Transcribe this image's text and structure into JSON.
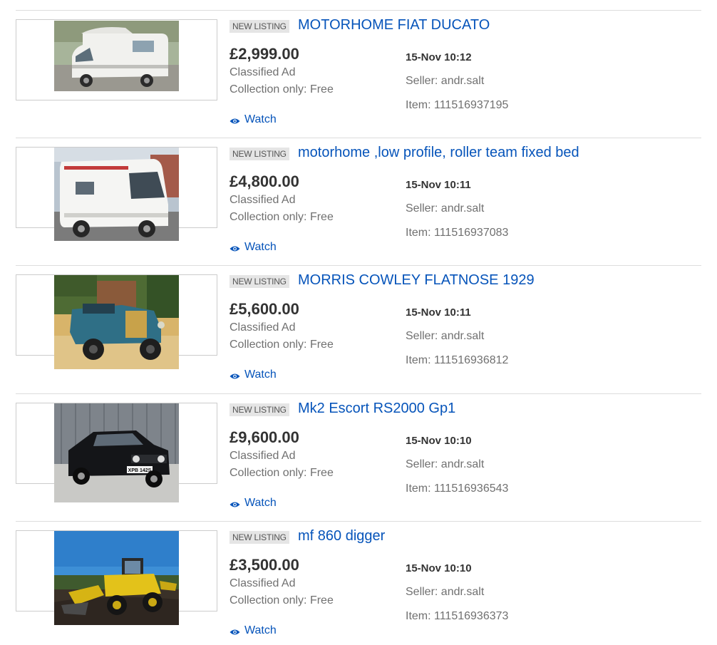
{
  "listings": [
    {
      "tag": "NEW LISTING",
      "title": "MOTORHOME FIAT DUCATO",
      "price": "£2,999.00",
      "format": "Classified Ad",
      "postage": "Collection only: Free",
      "watch": "Watch",
      "time": "15-Nov 10:12",
      "seller": "Seller: andr.salt",
      "item": "Item: 111516937195",
      "image": "white-motorhome-photo"
    },
    {
      "tag": "NEW LISTING",
      "title": "motorhome ,low profile, roller team fixed bed",
      "price": "£4,800.00",
      "format": "Classified Ad",
      "postage": "Collection only: Free",
      "watch": "Watch",
      "time": "15-Nov 10:11",
      "seller": "Seller: andr.salt",
      "item": "Item: 111516937083",
      "image": "white-low-profile-motorhome-photo"
    },
    {
      "tag": "NEW LISTING",
      "title": "MORRIS COWLEY FLATNOSE 1929",
      "price": "£5,600.00",
      "format": "Classified Ad",
      "postage": "Collection only: Free",
      "watch": "Watch",
      "time": "15-Nov 10:11",
      "seller": "Seller: andr.salt",
      "item": "Item: 111516936812",
      "image": "vintage-blue-car-photo"
    },
    {
      "tag": "NEW LISTING",
      "title": "Mk2 Escort RS2000 Gp1",
      "price": "£9,600.00",
      "format": "Classified Ad",
      "postage": "Collection only: Free",
      "watch": "Watch",
      "time": "15-Nov 10:10",
      "seller": "Seller: andr.salt",
      "item": "Item: 111516936543",
      "image": "black-escort-car-photo",
      "plate": "XPB 142S"
    },
    {
      "tag": "NEW LISTING",
      "title": "mf 860 digger",
      "price": "£3,500.00",
      "format": "Classified Ad",
      "postage": "Collection only: Free",
      "watch": "Watch",
      "time": "15-Nov 10:10",
      "seller": "Seller: andr.salt",
      "item": "Item: 111516936373",
      "image": "yellow-digger-photo"
    }
  ],
  "colors": {
    "link": "#0654ba",
    "price": "#333333",
    "muted": "#707070",
    "tag_bg": "#e5e5e5",
    "divider": "#dddddd"
  }
}
